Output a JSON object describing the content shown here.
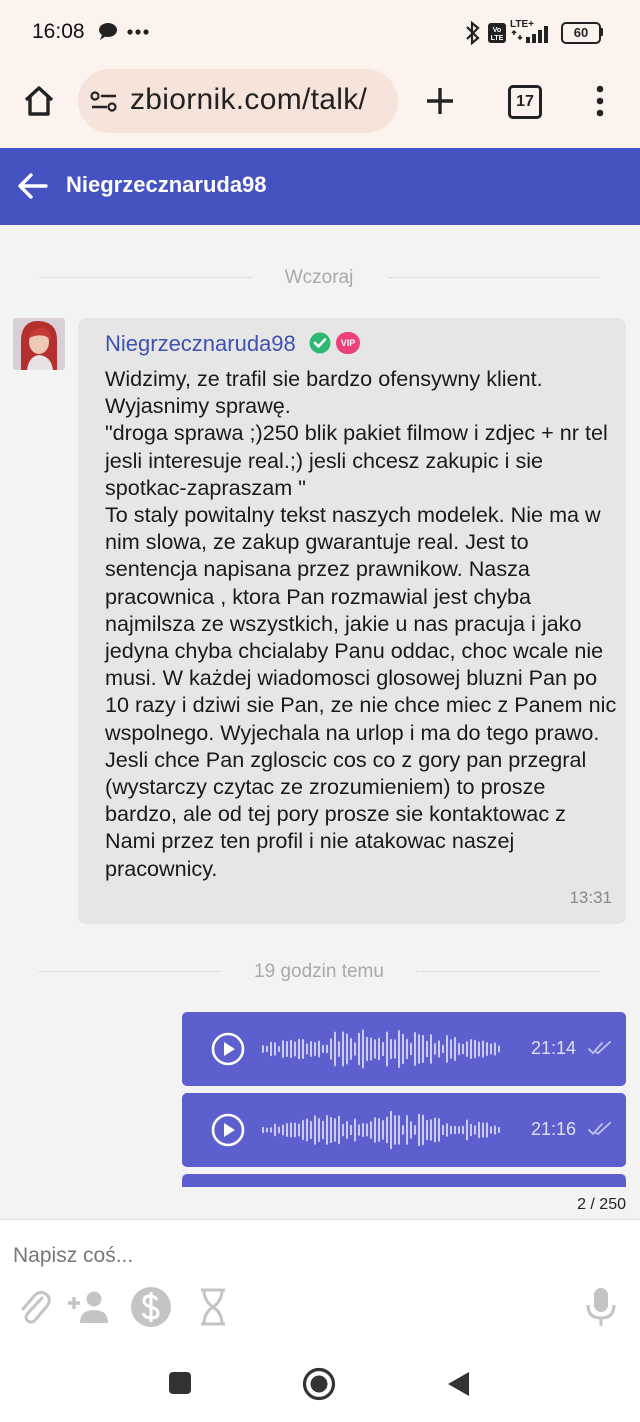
{
  "status_bar": {
    "time": "16:08",
    "battery": "60",
    "network": "LTE+",
    "icons": [
      "chat-bubble-icon",
      "more-dots-icon",
      "bluetooth-icon",
      "volte-icon",
      "signal-icon",
      "battery-icon"
    ]
  },
  "browser": {
    "url": "zbiornik.com/talk/",
    "tab_count": "17",
    "icons": [
      "home-icon",
      "site-settings-icon",
      "new-tab-plus-icon",
      "tabs-icon",
      "overflow-menu-icon"
    ]
  },
  "chat_header": {
    "title": "Niegrzecznaruda98",
    "back_icon": "arrow-left-icon"
  },
  "conversation": {
    "day_divider_1": "Wczoraj",
    "message_1": {
      "sender": "Niegrzecznaruda98",
      "vip_badge": "VIP",
      "text": "Widzimy, ze trafil sie bardzo ofensywny klient.\nWyjasnimy sprawę.\n\"droga sprawa ;)250 blik pakiet filmow i zdjec + nr tel jesli interesuje real.;) jesli chcesz zakupic i sie spotkac-zapraszam \"\nTo staly powitalny tekst naszych modelek. Nie ma w nim slowa, ze zakup gwarantuje real. Jest to sentencja napisana przez prawnikow. Nasza pracownica , ktora Pan rozmawial jest chyba najmilsza ze wszystkich, jakie u nas pracuja i jako jedyna chyba chcialaby Panu oddac, choc wcale nie musi. W każdej wiadomosci glosowej bluzni Pan po 10 razy i dziwi sie Pan, ze nie chce miec z Panem nic wspolnego. Wyjechala na urlop i ma do tego prawo. Jesli chce Pan zgloscic cos co z gory pan przegral (wystarczy czytac ze zrozumieniem) to prosze bardzo, ale od tej pory prosze sie kontaktowac z Nami przez ten profil i nie atakowac naszej pracownicy.",
      "time": "13:31"
    },
    "day_divider_2": "19 godzin temu",
    "voice_messages": [
      {
        "time": "21:14",
        "status": "read"
      },
      {
        "time": "21:16",
        "status": "read"
      }
    ]
  },
  "composer": {
    "char_counter": "2 / 250",
    "placeholder": "Napisz coś...",
    "icons": [
      "paperclip-icon",
      "add-person-icon",
      "dollar-icon",
      "hourglass-icon",
      "microphone-icon"
    ]
  },
  "nav_bar": {
    "icons": [
      "recents-square-icon",
      "home-circle-icon",
      "back-triangle-icon"
    ]
  },
  "colors": {
    "header_bg": "#4552c2",
    "voice_bubble": "#5c5fcd",
    "incoming_bubble": "#e6e6e6",
    "sender_name": "#3f51b5",
    "verified_green": "#2eb872",
    "vip_pink": "#ec407a",
    "browser_bar": "#fdf3ee"
  }
}
